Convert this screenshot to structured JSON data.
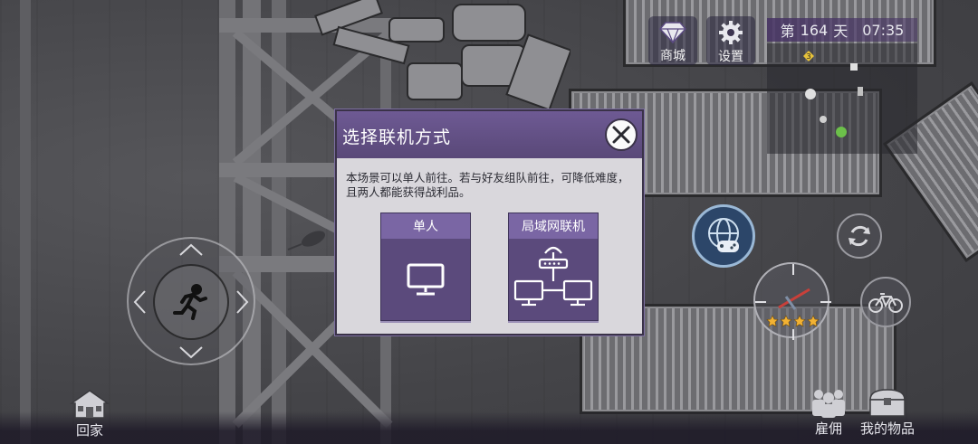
{
  "hud": {
    "shop_label": "商城",
    "settings_label": "设置",
    "day_prefix": "第",
    "day_number": "164",
    "day_suffix": "天",
    "time": "07:35",
    "minimap_marker": "3"
  },
  "dialog": {
    "title": "选择联机方式",
    "description": "本场景可以单人前往。若与好友组队前往，可降低难度，且两人都能获得战利品。",
    "options": [
      {
        "label": "单人",
        "icon": "monitor-icon"
      },
      {
        "label": "局域网联机",
        "icon": "lan-network-icon"
      }
    ]
  },
  "bottom": {
    "home_label": "回家",
    "hire_label": "雇佣",
    "items_label": "我的物品"
  },
  "target": {
    "stars": 4
  },
  "colors": {
    "dialog_header": "#6e5a94",
    "card_bg": "#5b4a7c",
    "accent_star": "#f2b233"
  }
}
